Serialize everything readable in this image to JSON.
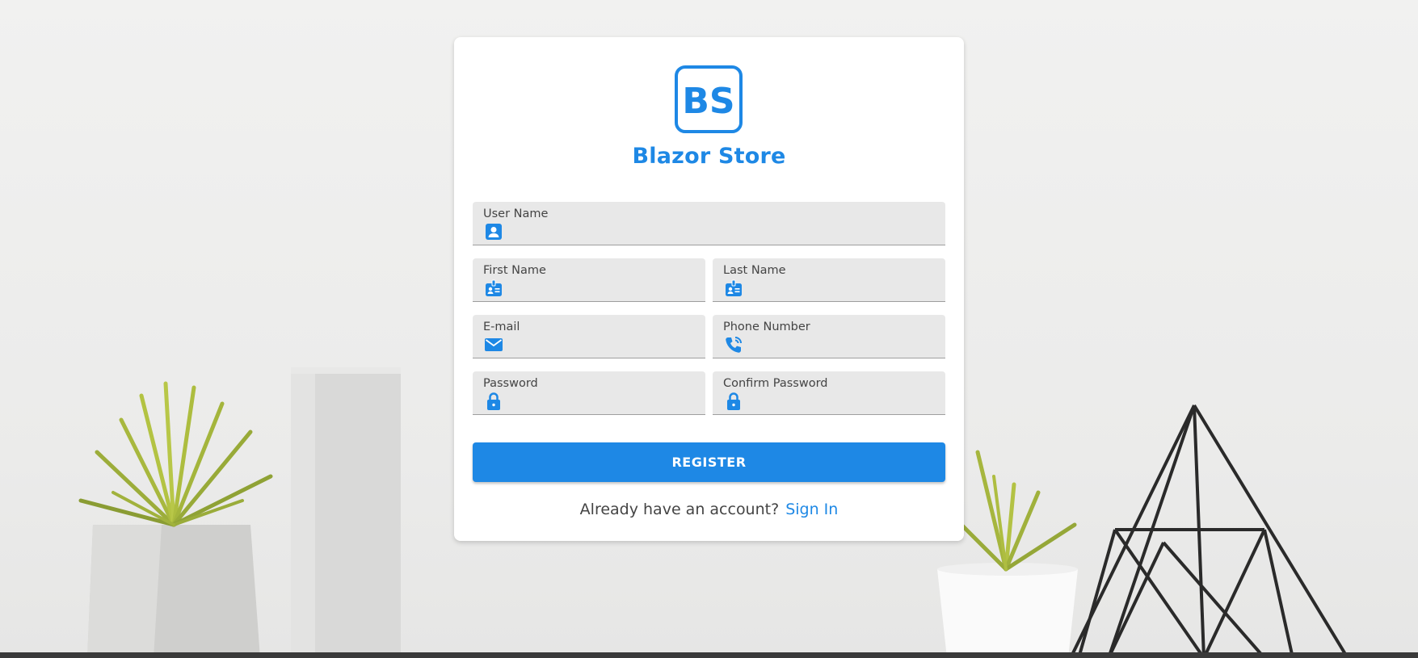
{
  "brand": {
    "name": "Blazor Store",
    "logo_text": "BS",
    "logo_icon": "bs-logo-icon",
    "accent_color": "#1e88e5"
  },
  "form": {
    "fields": [
      {
        "label": "User Name",
        "value": "",
        "icon": "person-icon"
      },
      {
        "label": "First Name",
        "value": "",
        "icon": "id-badge-icon"
      },
      {
        "label": "Last Name",
        "value": "",
        "icon": "id-badge-icon"
      },
      {
        "label": "E-mail",
        "value": "",
        "icon": "envelope-icon"
      },
      {
        "label": "Phone Number",
        "value": "",
        "icon": "phone-icon"
      },
      {
        "label": "Password",
        "value": "",
        "icon": "lock-icon"
      },
      {
        "label": "Confirm Password",
        "value": "",
        "icon": "lock-icon"
      }
    ],
    "submit_label": "REGISTER"
  },
  "footer": {
    "prompt": "Already have an account?",
    "link_label": "Sign In"
  }
}
